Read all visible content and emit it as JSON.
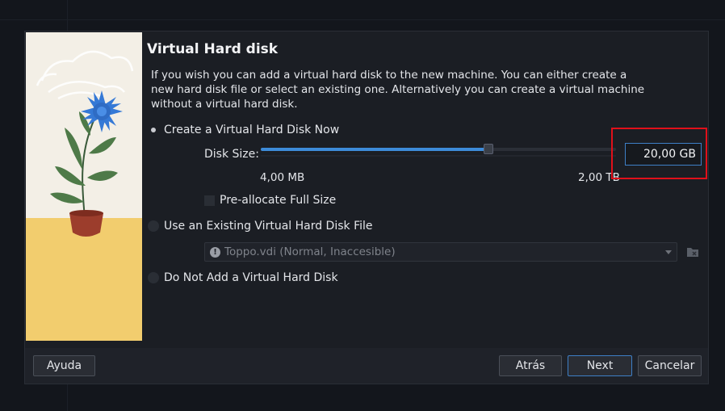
{
  "dialog": {
    "title": "Virtual Hard disk",
    "description": "If you wish you can add a virtual hard disk to the new machine. You can either create a new hard disk file or select an existing one. Alternatively you can create a virtual machine without a virtual hard disk."
  },
  "options": {
    "create_now": "Create a Virtual Hard Disk Now",
    "use_existing": "Use an Existing Virtual Hard Disk File",
    "do_not_add": "Do Not Add a Virtual Hard Disk",
    "selected": "create_now"
  },
  "disk": {
    "size_label": "Disk Size:",
    "size_value": "20,00 GB",
    "min_label": "4,00 MB",
    "max_label": "2,00 TB",
    "slider_fraction": 0.64,
    "preallocate_label": "Pre-allocate Full Size",
    "preallocate_checked": false
  },
  "existing_file": {
    "selected": "Toppo.vdi (Normal, Inaccesible)",
    "info_icon": "info-icon",
    "browse_icon": "folder-icon"
  },
  "buttons": {
    "help": "Ayuda",
    "back": "Atrás",
    "next": "Next",
    "cancel": "Cancelar"
  },
  "colors": {
    "accent": "#3d8bd9",
    "highlight": "#e0101a"
  }
}
